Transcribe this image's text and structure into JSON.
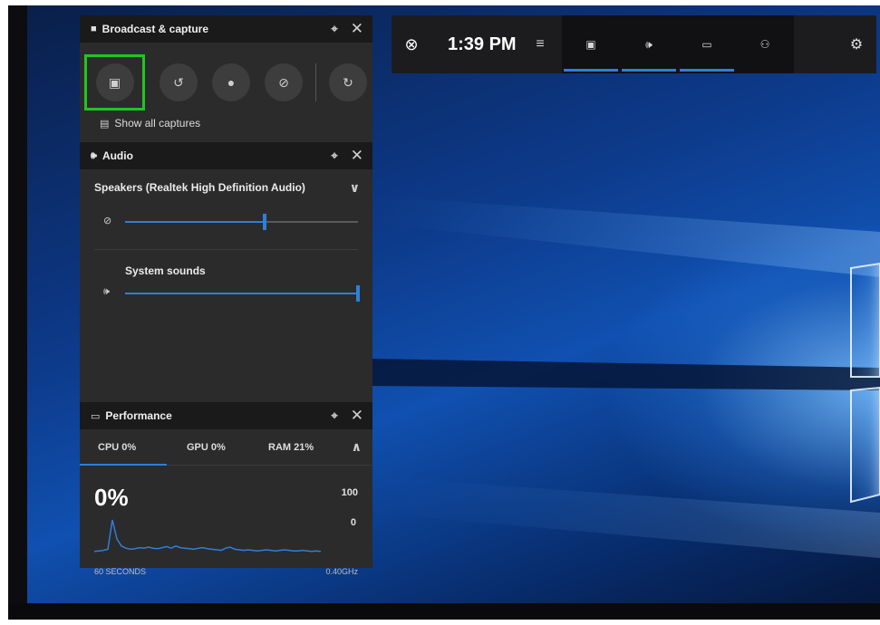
{
  "colors": {
    "accent": "#2f7fd6",
    "highlight": "#21c421",
    "panel_bg": "#2b2b2b",
    "header_bg": "#1a1a1a"
  },
  "topbar": {
    "xbox_icon": "xbox-logo-icon",
    "time": "1:39 PM",
    "menu_icon": "hamburger-icon",
    "widgets": [
      {
        "icon": "broadcast-capture-icon",
        "active": true
      },
      {
        "icon": "audio-icon",
        "active": true
      },
      {
        "icon": "performance-icon",
        "active": true
      },
      {
        "icon": "xbox-social-icon",
        "active": false
      }
    ],
    "settings_icon": "gear-icon"
  },
  "capture": {
    "title": "Broadcast & capture",
    "buttons": [
      {
        "icon": "screenshot-camera-icon",
        "highlighted": true
      },
      {
        "icon": "record-last-icon",
        "highlighted": false
      },
      {
        "icon": "record-dot-icon",
        "highlighted": false
      },
      {
        "icon": "mic-off-icon",
        "highlighted": false
      },
      {
        "icon": "broadcast-icon",
        "highlighted": false
      }
    ],
    "show_all_label": "Show all captures"
  },
  "audio": {
    "title": "Audio",
    "device": "Speakers (Realtek High Definition Audio)",
    "master_volume": 0.6,
    "master_muted": true,
    "apps": [
      {
        "label": "System sounds",
        "volume": 1.0
      }
    ]
  },
  "performance": {
    "title": "Performance",
    "tabs": [
      {
        "label": "CPU  0%",
        "selected": true
      },
      {
        "label": "GPU  0%",
        "selected": false
      },
      {
        "label": "RAM  21%",
        "selected": false
      }
    ],
    "current_value": "0%",
    "axis_max": "100",
    "axis_min": "0",
    "time_window": "60 SECONDS",
    "frequency": "0.40GHz",
    "history": [
      2,
      3,
      4,
      6,
      60,
      25,
      12,
      8,
      6,
      7,
      9,
      8,
      10,
      8,
      7,
      9,
      11,
      8,
      12,
      9,
      8,
      7,
      6,
      8,
      9,
      7,
      6,
      5,
      4,
      8,
      10,
      6,
      5,
      4,
      5,
      4,
      3,
      4,
      5,
      4,
      3,
      4,
      5,
      4,
      3,
      3,
      4,
      3,
      2,
      3,
      2
    ]
  }
}
